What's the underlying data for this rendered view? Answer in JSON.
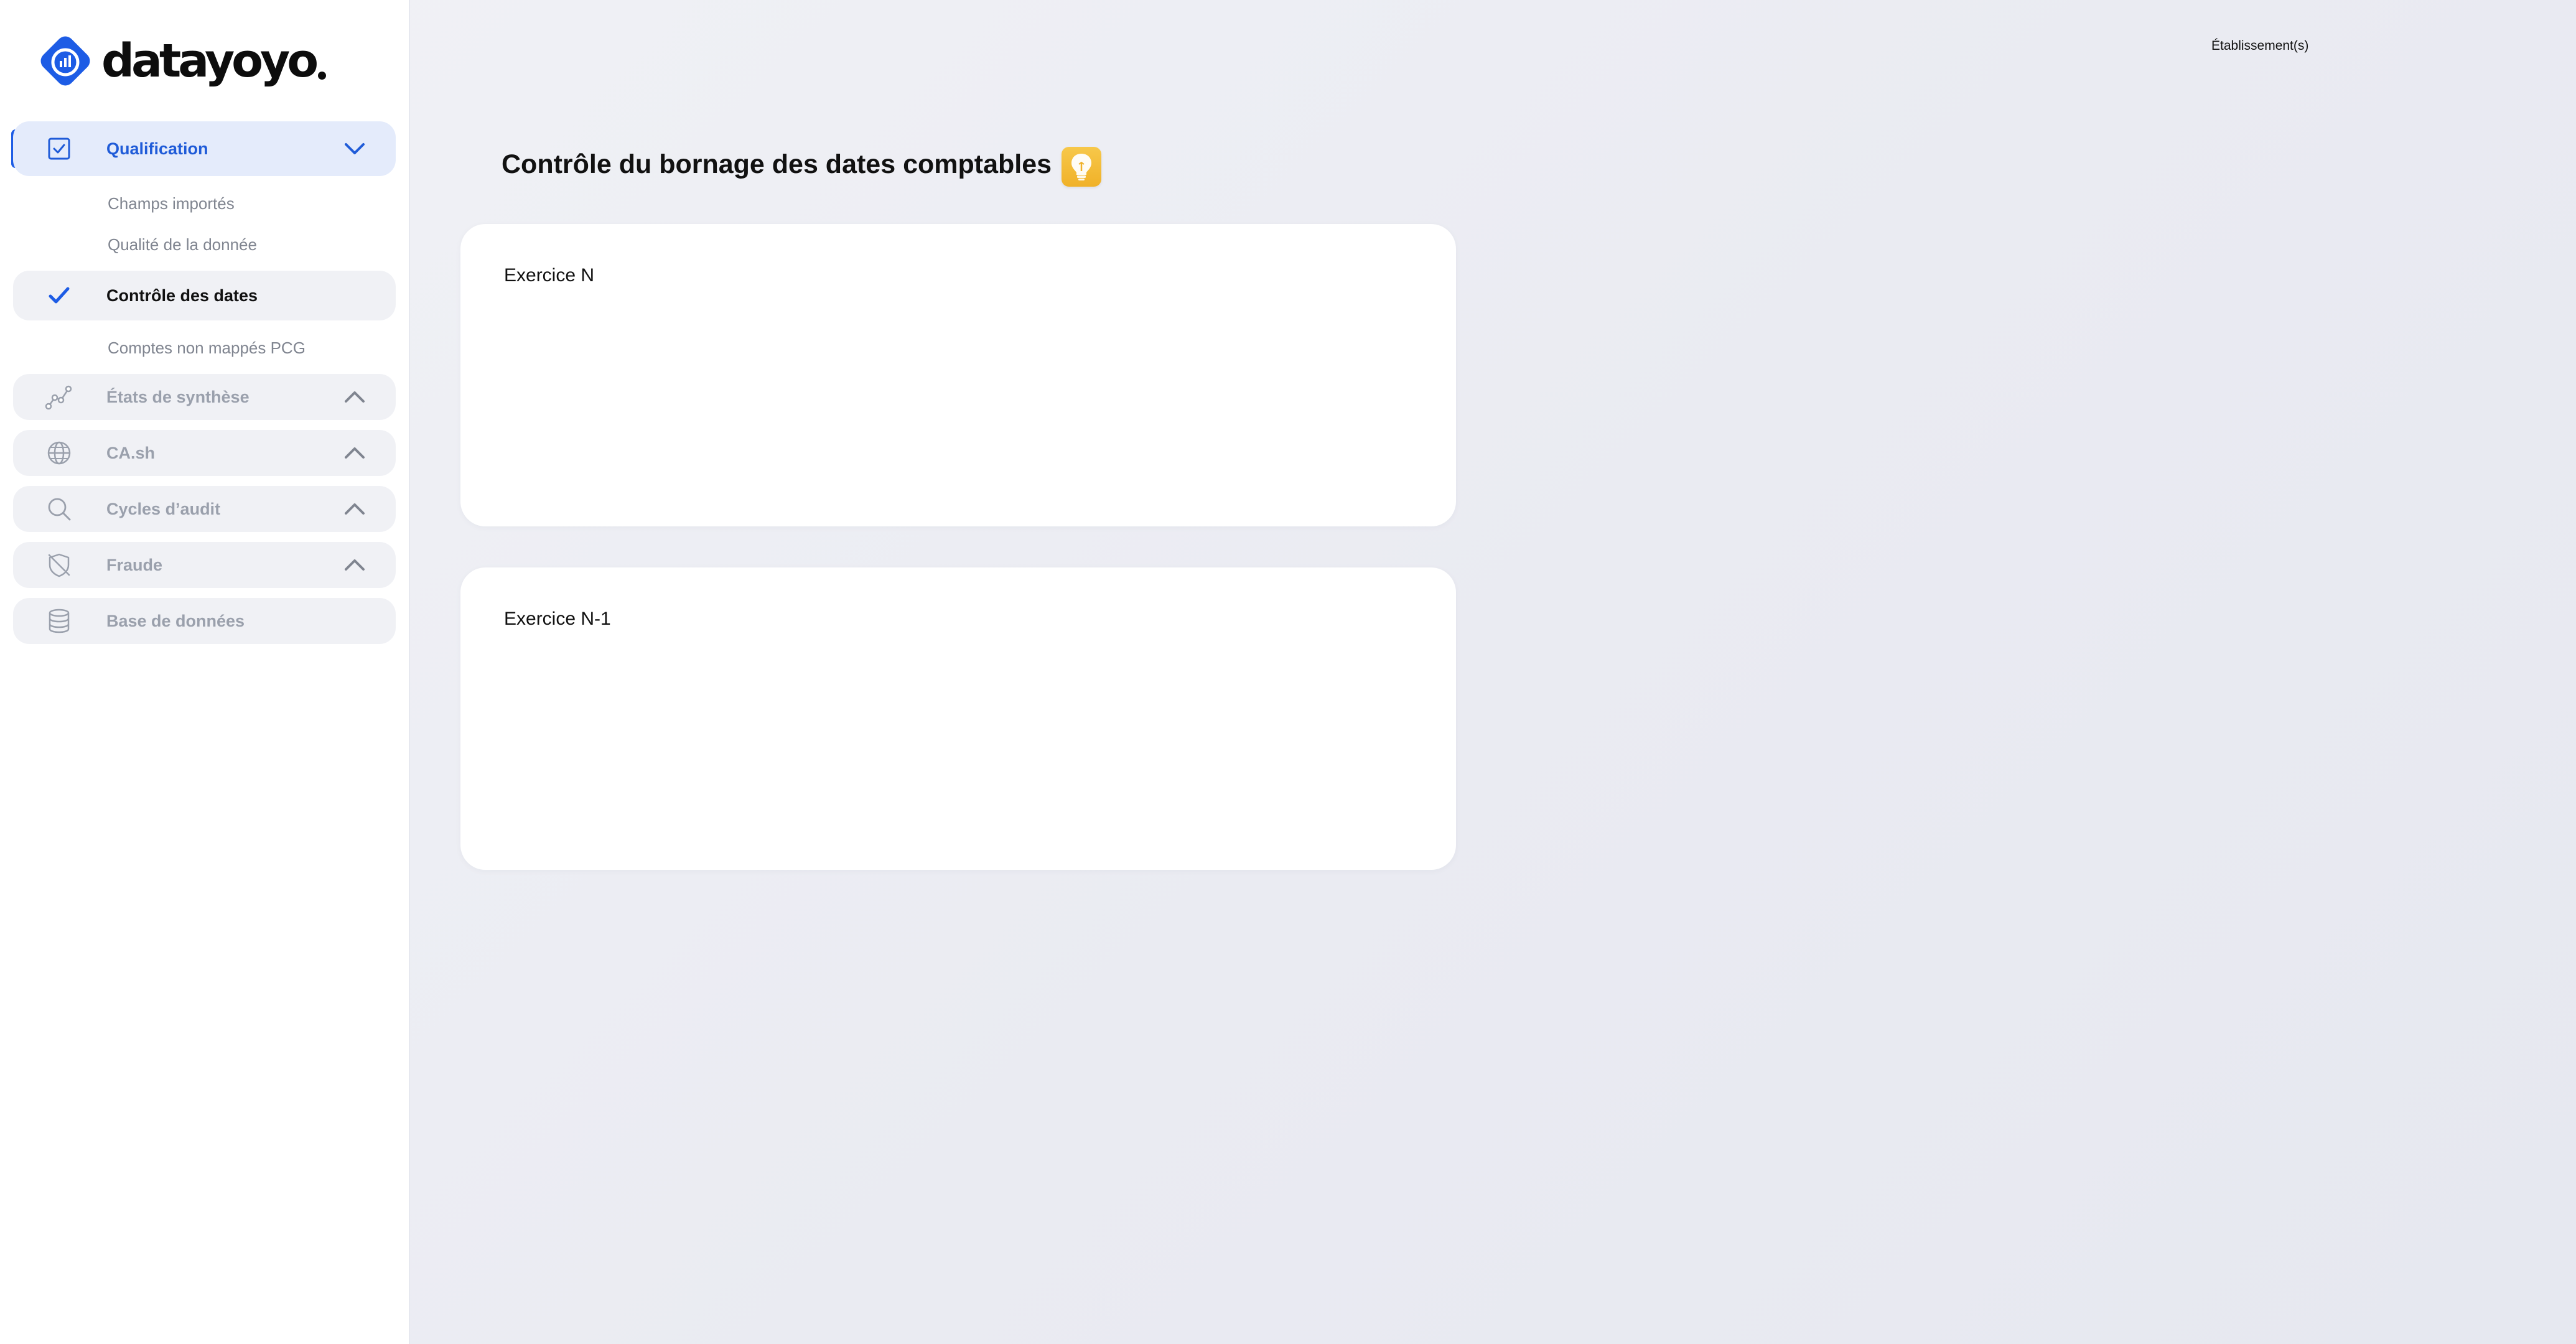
{
  "brand": {
    "name": "datayoyo",
    "accent_color": "#1d5ce5",
    "logo_icon": "chart-logo-icon"
  },
  "header": {
    "establishment_label": "Établissement(s)"
  },
  "sidebar": {
    "sections": [
      {
        "label": "Qualification",
        "icon": "checkbox-icon",
        "chevron": "chevron-down-icon",
        "state": "expanded"
      },
      {
        "label": "États de synthèse",
        "icon": "line-chart-icon",
        "chevron": "chevron-up-icon",
        "state": "collapsed"
      },
      {
        "label": "CA.sh",
        "icon": "globe-icon",
        "chevron": "chevron-up-icon",
        "state": "collapsed"
      },
      {
        "label": "Cycles d’audit",
        "icon": "search-icon",
        "chevron": "chevron-up-icon",
        "state": "collapsed"
      },
      {
        "label": "Fraude",
        "icon": "shield-off-icon",
        "chevron": "chevron-up-icon",
        "state": "collapsed"
      },
      {
        "label": "Base de données",
        "icon": "database-icon",
        "state": "none"
      }
    ],
    "qualification_items": [
      {
        "label": "Champs importés"
      },
      {
        "label": "Qualité de la donnée"
      },
      {
        "label": "Contrôle des dates",
        "icon": "check-icon",
        "current": true
      },
      {
        "label": "Comptes non mappés PCG"
      }
    ]
  },
  "main": {
    "title": "Contrôle du bornage des dates comptables",
    "tip_icon": "lightbulb-icon",
    "cards": [
      {
        "title": "Exercice N"
      },
      {
        "title": "Exercice N-1"
      }
    ]
  }
}
